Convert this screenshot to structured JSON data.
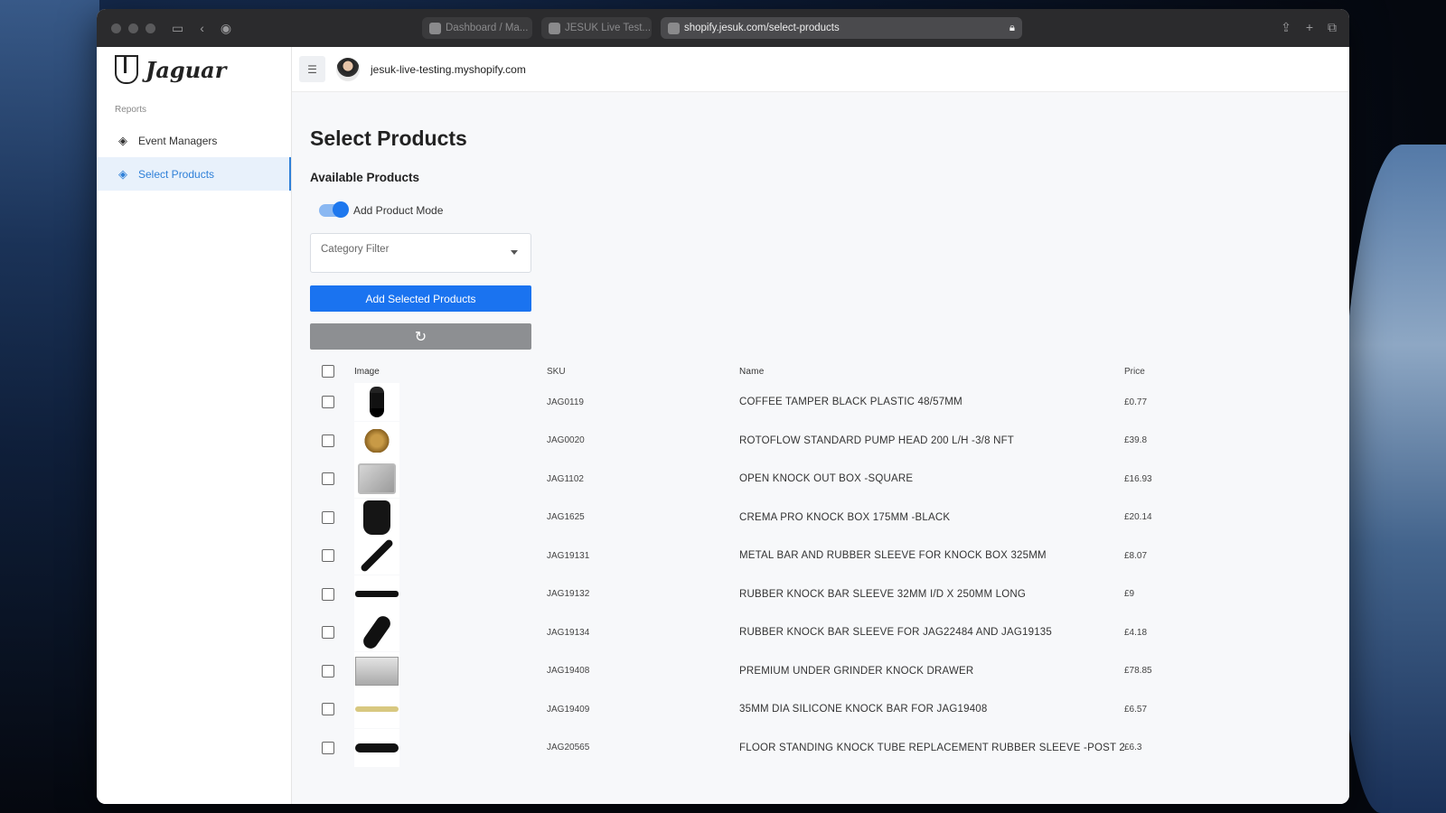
{
  "browser": {
    "tabs": [
      {
        "label": "Dashboard / Ma..."
      },
      {
        "label": "JESUK Live Test..."
      }
    ],
    "address": "shopify.jesuk.com/select-products"
  },
  "sidebar": {
    "logo_text": "Jaguar",
    "section_label": "Reports",
    "items": [
      {
        "label": "Event Managers"
      },
      {
        "label": "Select Products"
      }
    ]
  },
  "topbar": {
    "shop_domain": "jesuk-live-testing.myshopify.com"
  },
  "page": {
    "title": "Select Products",
    "subtitle": "Available Products",
    "toggle_label": "Add Product Mode",
    "toggle_on": true,
    "category_placeholder": "Category Filter",
    "add_button": "Add Selected Products"
  },
  "table": {
    "headers": {
      "image": "Image",
      "sku": "SKU",
      "name": "Name",
      "price": "Price"
    },
    "rows": [
      {
        "sku": "JAG0119",
        "name": "COFFEE TAMPER BLACK PLASTIC 48/57MM",
        "price": "£0.77",
        "image": "tamper"
      },
      {
        "sku": "JAG0020",
        "name": "ROTOFLOW STANDARD PUMP HEAD 200 L/H -3/8 NFT",
        "price": "£39.8",
        "image": "pump"
      },
      {
        "sku": "JAG1102",
        "name": "OPEN KNOCK OUT BOX -SQUARE",
        "price": "£16.93",
        "image": "box"
      },
      {
        "sku": "JAG1625",
        "name": "CREMA PRO KNOCK BOX 175MM -BLACK",
        "price": "£20.14",
        "image": "knock"
      },
      {
        "sku": "JAG19131",
        "name": "METAL BAR AND RUBBER SLEEVE FOR KNOCK BOX 325MM",
        "price": "£8.07",
        "image": "bar"
      },
      {
        "sku": "JAG19132",
        "name": "RUBBER KNOCK BAR SLEEVE 32MM I/D X 250MM LONG",
        "price": "£9",
        "image": "sleeve"
      },
      {
        "sku": "JAG19134",
        "name": "RUBBER KNOCK BAR SLEEVE FOR JAG22484 AND JAG19135",
        "price": "£4.18",
        "image": "sleeve2"
      },
      {
        "sku": "JAG19408",
        "name": "PREMIUM UNDER GRINDER KNOCK DRAWER",
        "price": "£78.85",
        "image": "drawer"
      },
      {
        "sku": "JAG19409",
        "name": "35MM DIA SILICONE KNOCK BAR FOR JAG19408",
        "price": "£6.57",
        "image": "silicone"
      },
      {
        "sku": "JAG20565",
        "name": "FLOOR STANDING KNOCK TUBE REPLACEMENT RUBBER SLEEVE -POST 2(",
        "price": "£6.3",
        "image": "tube"
      }
    ]
  },
  "colors": {
    "accent": "#1a73f0",
    "sidebar_active_bg": "#e8f1fb",
    "reset_button": "#8d8f92"
  }
}
